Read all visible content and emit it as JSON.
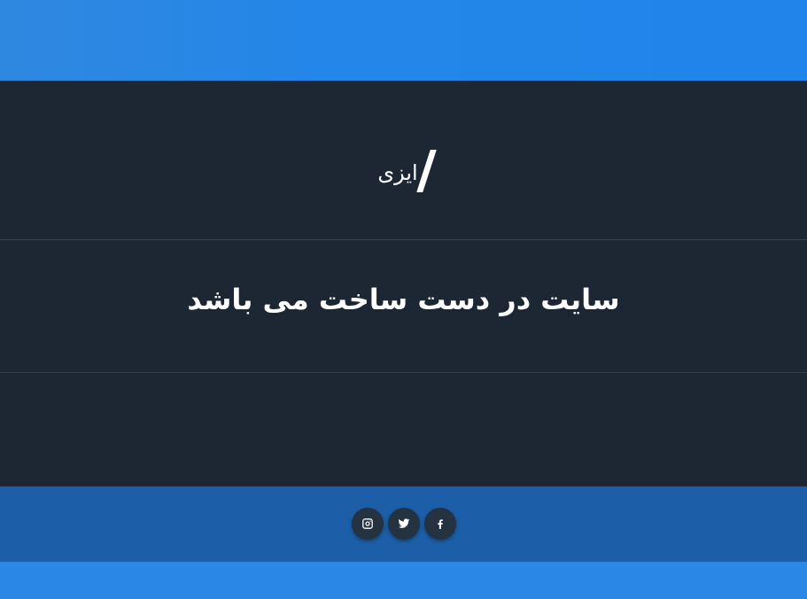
{
  "brand": {
    "logo_text": "ایزی"
  },
  "hero": {
    "headline": "سایت در دست ساخت می باشد"
  },
  "social": [
    {
      "name": "instagram",
      "icon": "instagram-icon"
    },
    {
      "name": "twitter",
      "icon": "twitter-icon"
    },
    {
      "name": "facebook",
      "icon": "facebook-icon"
    }
  ],
  "colors": {
    "accent_blue": "#1f86e6",
    "panel_dark": "#1d2733",
    "social_button": "#253240"
  }
}
